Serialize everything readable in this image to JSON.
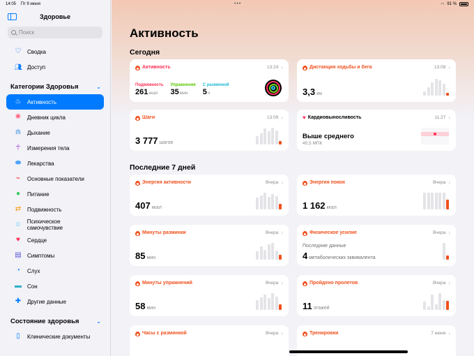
{
  "status": {
    "time": "14:05",
    "date": "Пт 9 июня",
    "battery": "91 %"
  },
  "sidebar": {
    "title": "Здоровье",
    "search_placeholder": "Поиск",
    "top_items": [
      {
        "label": "Сводка",
        "icon": "heart-outline-icon"
      },
      {
        "label": "Доступ",
        "icon": "people-icon"
      }
    ],
    "categories_header": "Категории Здоровья",
    "categories": [
      {
        "label": "Активность",
        "icon": "flame-icon",
        "active": true
      },
      {
        "label": "Дневник цикла",
        "icon": "cycle-icon"
      },
      {
        "label": "Дыхание",
        "icon": "lungs-icon"
      },
      {
        "label": "Измерения тела",
        "icon": "body-figure-icon"
      },
      {
        "label": "Лекарства",
        "icon": "pills-icon"
      },
      {
        "label": "Основные показатели",
        "icon": "vitals-icon"
      },
      {
        "label": "Питание",
        "icon": "apple-icon"
      },
      {
        "label": "Подвижность",
        "icon": "mobility-icon"
      },
      {
        "label": "Психическое самочувствие",
        "icon": "head-icon"
      },
      {
        "label": "Сердце",
        "icon": "heart-icon"
      },
      {
        "label": "Симптомы",
        "icon": "symptoms-icon"
      },
      {
        "label": "Слух",
        "icon": "ear-icon"
      },
      {
        "label": "Сон",
        "icon": "bed-icon"
      },
      {
        "label": "Другие данные",
        "icon": "plus-icon"
      }
    ],
    "state_header": "Состояние здоровья",
    "state_items": [
      {
        "label": "Клинические документы",
        "icon": "document-icon"
      }
    ]
  },
  "main": {
    "title": "Активность",
    "today_header": "Сегодня",
    "week_header": "Последние 7 дней",
    "activity": {
      "title": "Активность",
      "time": "13:24",
      "move_label": "Подвижность",
      "move_value": "261",
      "move_unit": "ккал",
      "exercise_label": "Упражнения",
      "exercise_value": "35",
      "exercise_unit": "мин",
      "stand_label": "С разминкой",
      "stand_value": "5",
      "stand_unit": "ч"
    },
    "distance": {
      "title": "Дистанция ходьбы и бега",
      "time": "13:09",
      "value": "3,3",
      "unit": "км",
      "bars": [
        0.25,
        0.5,
        0.8,
        1.0,
        0.9,
        0.7,
        0.15
      ]
    },
    "steps": {
      "title": "Шаги",
      "time": "13:09",
      "value": "3 777",
      "unit": "шагов",
      "bars": [
        0.5,
        0.65,
        0.95,
        0.8,
        1.0,
        0.85,
        0.2
      ]
    },
    "cardio": {
      "title": "Кардиовыносливость",
      "time": "11:27",
      "value": "Выше среднего",
      "sub": "45,5 МПК"
    },
    "energy": {
      "title": "Энергия активности",
      "meta": "Вчера",
      "value": "407",
      "unit": "ккал",
      "bars": [
        0.7,
        0.85,
        1.0,
        0.75,
        0.9,
        0.8,
        0.35
      ]
    },
    "rest_energy": {
      "title": "Энергия покоя",
      "meta": "Вчера",
      "value": "1 162",
      "unit": "ккал",
      "bars": [
        1.0,
        1.0,
        1.0,
        1.0,
        1.0,
        1.0,
        0.6
      ]
    },
    "warmup_min": {
      "title": "Минуты разминки",
      "meta": "Вчера",
      "value": "85",
      "unit": "мин",
      "bars": [
        0.5,
        0.8,
        0.6,
        0.9,
        1.0,
        0.55,
        0.3
      ]
    },
    "physical_effort": {
      "title": "Физическое усилие",
      "meta": "Вчера",
      "sub": "Последние данные",
      "value": "4",
      "unit": "метаболических эквивалента",
      "bars": [
        0,
        0,
        0,
        0,
        0,
        1.0,
        0.25
      ]
    },
    "exercise_min": {
      "title": "Минуты упражнений",
      "meta": "Вчера",
      "value": "58",
      "unit": "мин",
      "bars": [
        0.6,
        0.75,
        0.9,
        0.7,
        1.0,
        0.8,
        0.35
      ]
    },
    "flights": {
      "title": "Пройдено пролетов",
      "meta": "Вчера",
      "value": "11",
      "unit": "этажей",
      "bars": [
        0.5,
        0.2,
        0.9,
        0.35,
        1.0,
        0.6,
        0.55
      ]
    },
    "stand_hours": {
      "title": "Часы с разминкой",
      "meta": "Вчера"
    },
    "workouts": {
      "title": "Тренировки",
      "meta": "7 июня"
    }
  }
}
